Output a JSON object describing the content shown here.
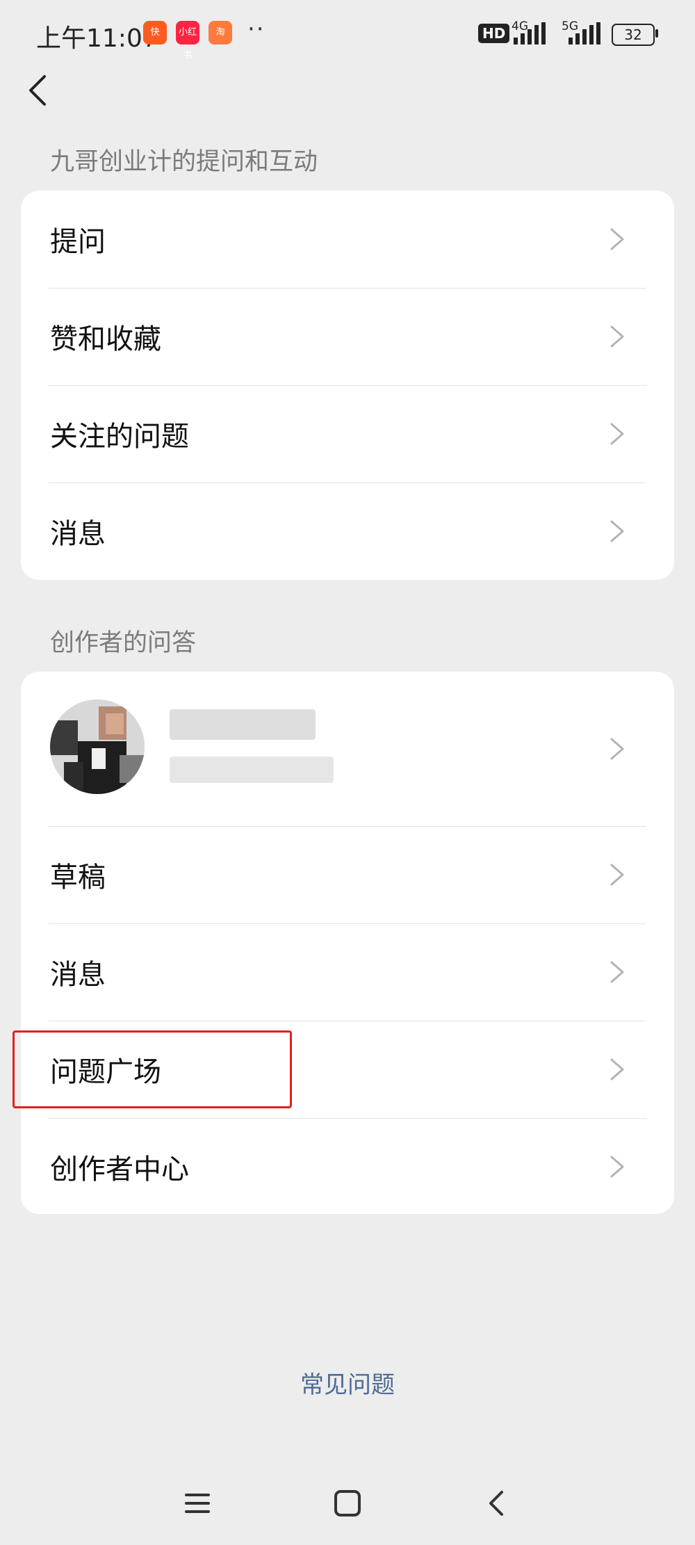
{
  "status_bar": {
    "time": "上午11:07",
    "apps": [
      "快手极速版",
      "小红书",
      "淘宝"
    ],
    "more": "··",
    "hd": "HD",
    "net1": "4G",
    "net2": "5G",
    "battery": "32"
  },
  "nav": {
    "back_icon": "chevron-left-icon"
  },
  "section1": {
    "title": "九哥创业计的提问和互动",
    "items": [
      {
        "label": "提问"
      },
      {
        "label": "赞和收藏"
      },
      {
        "label": "关注的问题"
      },
      {
        "label": "消息"
      }
    ]
  },
  "section2": {
    "title": "创作者的问答",
    "profile": {
      "avatar": "avatar-image"
    },
    "items": [
      {
        "label": "草稿"
      },
      {
        "label": "消息"
      },
      {
        "label": "问题广场"
      },
      {
        "label": "创作者中心"
      }
    ]
  },
  "footer": {
    "faq": "常见问题"
  },
  "colors": {
    "background": "#ededed",
    "card": "#ffffff",
    "link": "#4e6b95",
    "highlight": "#e02020"
  }
}
